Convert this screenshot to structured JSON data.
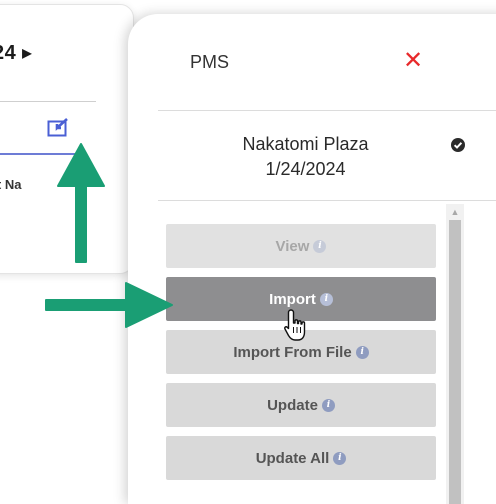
{
  "background_card": {
    "date_partial": "24",
    "date_arrow": "▶",
    "column_header_partial": "unt Na"
  },
  "panel": {
    "title": "PMS",
    "close_glyph": "✕",
    "property_name": "Nakatomi Plaza",
    "property_date": "1/24/2024",
    "actions": [
      {
        "label": "View",
        "state": "disabled"
      },
      {
        "label": "Import",
        "state": "active"
      },
      {
        "label": "Import From File",
        "state": "normal"
      },
      {
        "label": "Update",
        "state": "normal"
      },
      {
        "label": "Update All",
        "state": "normal"
      }
    ],
    "info_glyph": "i"
  },
  "colors": {
    "close": "#e8292b",
    "arrow_green": "#1a9e74",
    "active_button": "#8e8e90",
    "button": "#d9d9d9"
  }
}
